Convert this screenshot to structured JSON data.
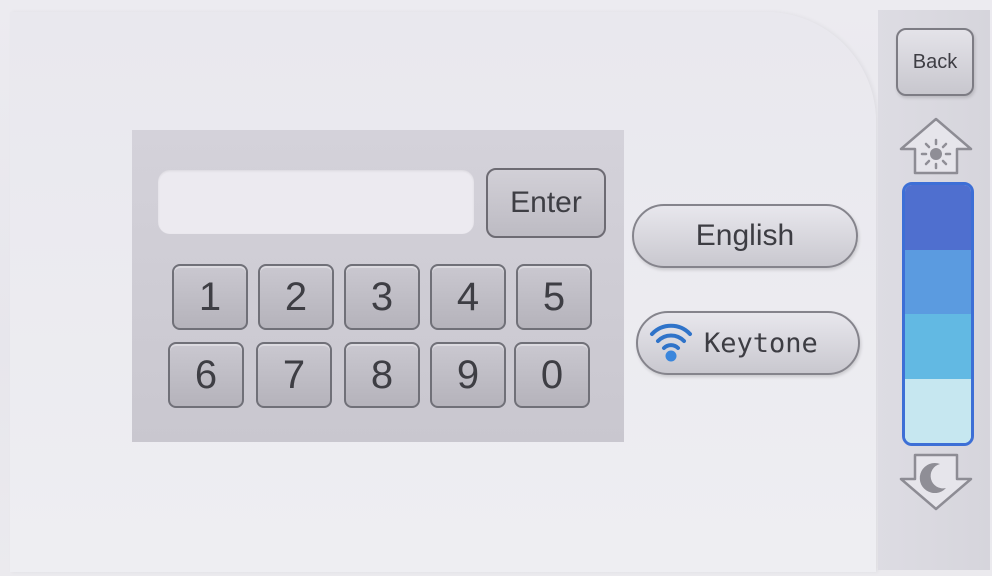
{
  "input": {
    "value": "",
    "placeholder": ""
  },
  "enter_label": "Enter",
  "keys": [
    "1",
    "2",
    "3",
    "4",
    "5",
    "6",
    "7",
    "8",
    "9",
    "0"
  ],
  "language_label": "English",
  "keytone_label": "Keytone",
  "back_label": "Back",
  "brightness": {
    "level": 0.75,
    "segment_colors": [
      "#4f6fcf",
      "#5b9be0",
      "#62b9e3",
      "#c6e7f0"
    ]
  },
  "icons": {
    "keytone": "wifi-signal-icon",
    "brightness_up": "sun-arrow-up-icon",
    "brightness_down": "moon-arrow-down-icon"
  }
}
